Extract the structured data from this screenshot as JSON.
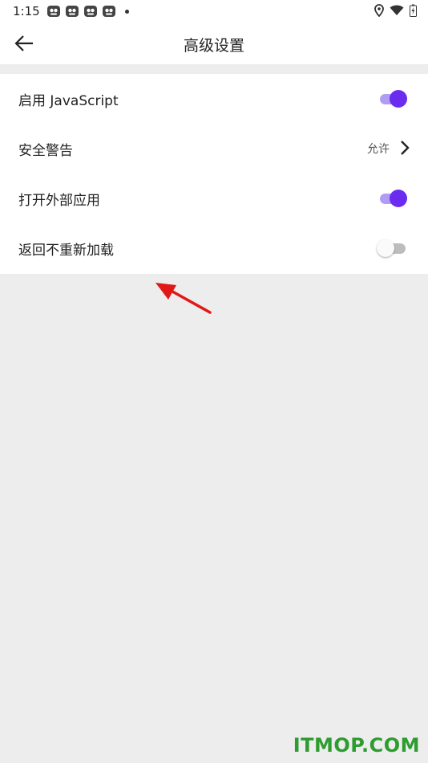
{
  "status_bar": {
    "time": "1:15"
  },
  "app_bar": {
    "title": "高级设置"
  },
  "settings": [
    {
      "label": "启用 JavaScript",
      "type": "toggle",
      "state": "on"
    },
    {
      "label": "安全警告",
      "type": "link",
      "value": "允许"
    },
    {
      "label": "打开外部应用",
      "type": "toggle",
      "state": "on"
    },
    {
      "label": "返回不重新加载",
      "type": "toggle",
      "state": "off"
    }
  ],
  "colors": {
    "accent": "#6a2df0",
    "accent_track": "#b19cf4",
    "background": "#ededed",
    "annotation_arrow": "#e01818"
  },
  "watermark": "ITMOP.COM"
}
